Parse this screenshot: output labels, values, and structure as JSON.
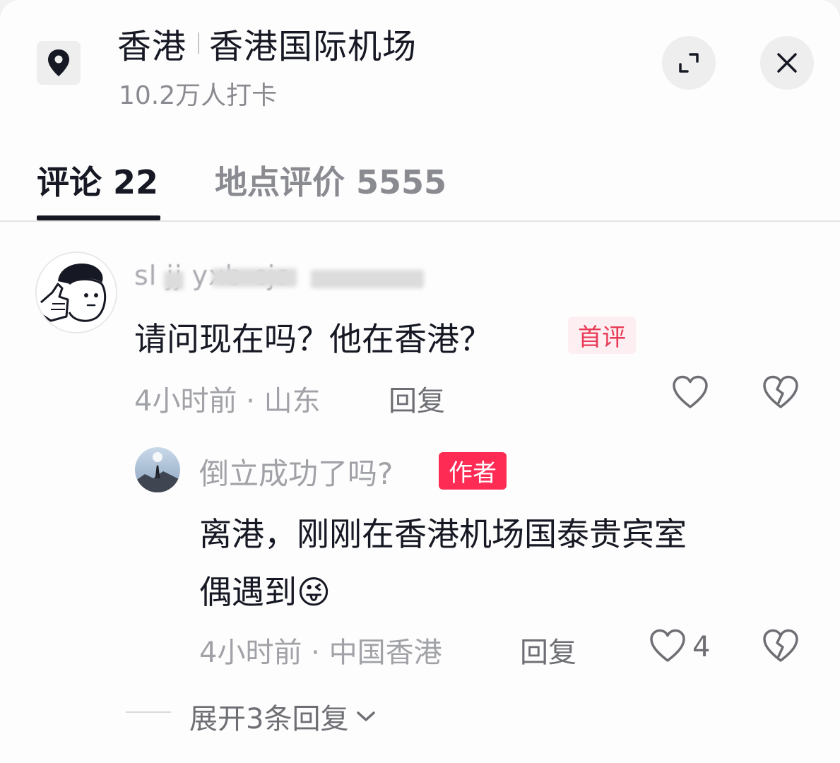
{
  "header": {
    "region": "香港",
    "place": "香港国际机场",
    "checkins": "10.2万人打卡",
    "icons": {
      "location": "location-pin-icon",
      "expand": "expand-icon",
      "close": "close-icon"
    }
  },
  "tabs": [
    {
      "label": "评论 22",
      "active": true
    },
    {
      "label": "地点评价 5555",
      "active": false
    }
  ],
  "comments": [
    {
      "username": "sl     jj       yxb  cjs",
      "text": "请问现在吗？他在香港？",
      "badge": "首评",
      "time": "4小时前",
      "location": "山东",
      "reply_label": "回复",
      "likes": "",
      "replies": [
        {
          "username": "倒立成功了吗?",
          "badge": "作者",
          "text_line1": "离港，刚刚在香港机场国泰贵宾室",
          "text_line2": "偶遇到",
          "emoji": "😜",
          "time": "4小时前",
          "location": "中国香港",
          "reply_label": "回复",
          "likes": "4"
        }
      ],
      "expand_label": "展开3条回复"
    }
  ],
  "colors": {
    "primary_text": "#161823",
    "secondary_text": "#a1a2a7",
    "accent_red": "#fe2c55",
    "first_badge_bg": "#fdeff1",
    "first_badge_text": "#e83a57"
  }
}
